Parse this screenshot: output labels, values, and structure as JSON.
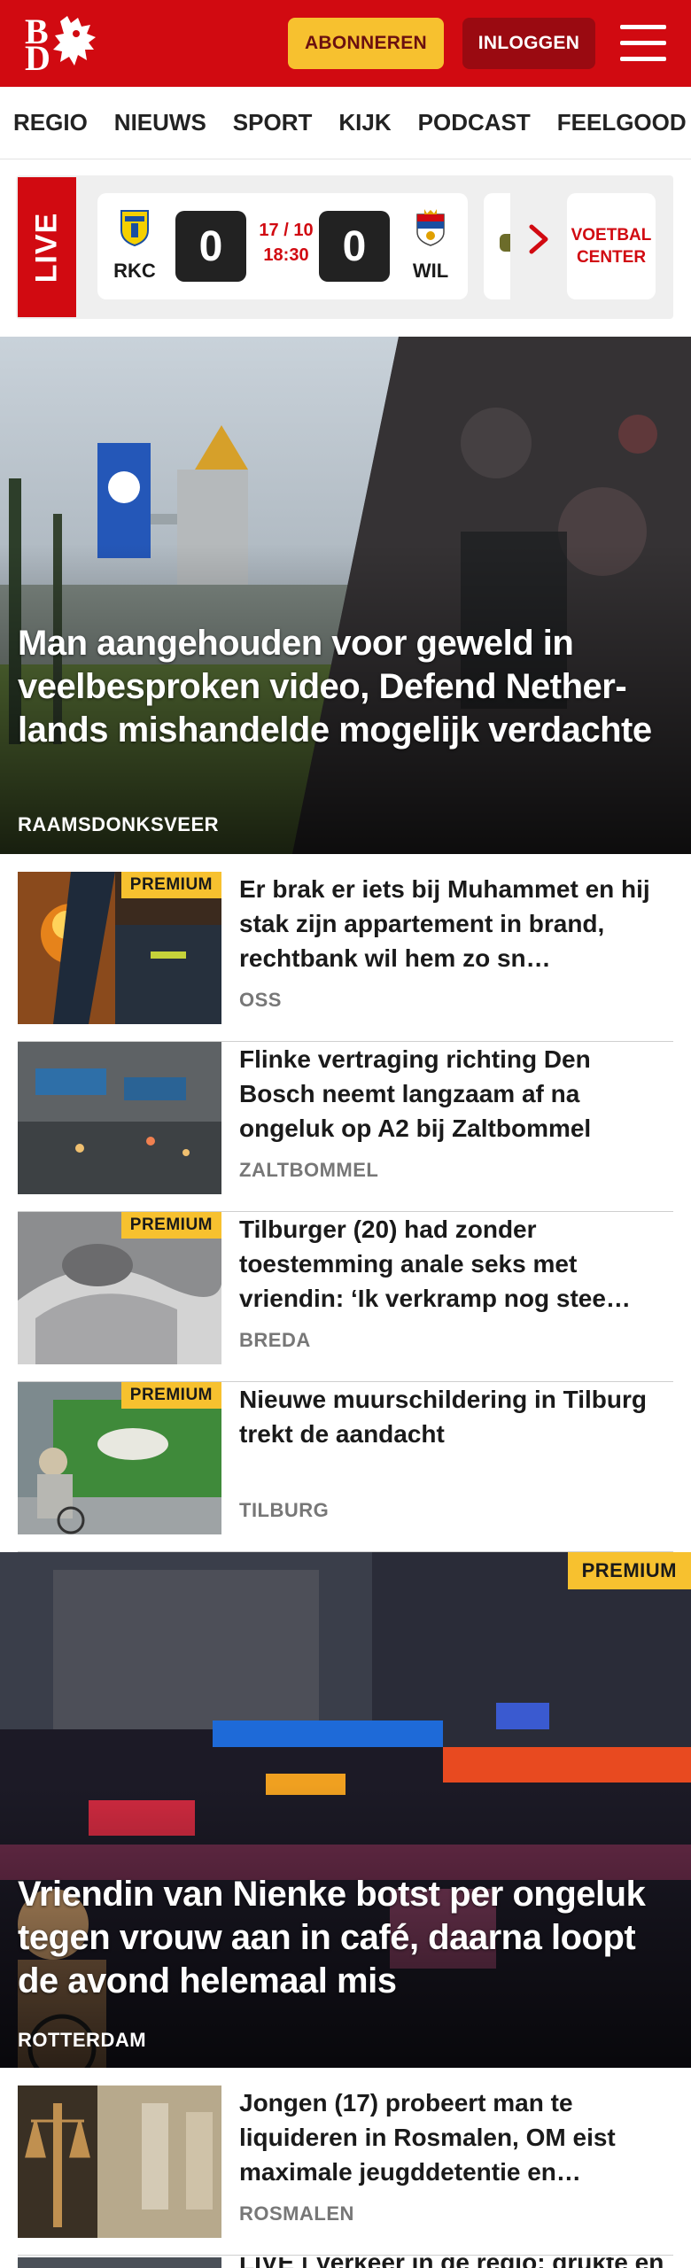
{
  "header": {
    "logo_letters": [
      "B",
      "D"
    ],
    "subscribe_label": "ABONNEREN",
    "login_label": "INLOGGEN",
    "menu_icon": "hamburger-icon",
    "brand_color": "#d10a11",
    "accent_color": "#f7c12f"
  },
  "nav": {
    "items": [
      "REGIO",
      "NIEUWS",
      "SPORT",
      "KIJK",
      "PODCAST",
      "FEELGOOD"
    ]
  },
  "live": {
    "badge": "LIVE",
    "match": {
      "home_team": "RKC",
      "home_score": "0",
      "date": "17 / 10",
      "time": "18:30",
      "away_score": "0",
      "away_team": "WIL"
    },
    "next_icon": "chevron-right-icon",
    "voetbal_center_label": "VOETBAL CENTER"
  },
  "hero": {
    "title": "Man aangehouden voor geweld in veelbesproken video, Defend Nether-lands mishandelde mogelijk verdachte",
    "location": "RAAMSDONKSVEER"
  },
  "articles": [
    {
      "premium": "PREMIUM",
      "title": "Er brak er iets bij Muhammet en hij stak zijn appartement in brand, rechtbank wil hem zo sn…",
      "location": "OSS"
    },
    {
      "premium": "",
      "title": "Flinke vertraging richting Den Bosch neemt langzaam af na ongeluk op A2 bij Zaltbommel",
      "location": "ZALTBOMMEL"
    },
    {
      "premium": "PREMIUM",
      "title": "Tilburger (20) had zonder toestemming anale seks met vriendin: ‘Ik verkramp nog stee…",
      "location": "BREDA"
    },
    {
      "premium": "PREMIUM",
      "title": "Nieuwe muurschildering in Tilburg trekt de aandacht",
      "location": "TILBURG"
    }
  ],
  "big_article": {
    "premium": "PREMIUM",
    "title": "Vriendin van Nienke botst per ongeluk tegen vrouw aan in café, daarna loopt de avond helemaal mis",
    "location": "ROTTERDAM"
  },
  "article_after": {
    "title": "Jongen (17) probeert man te liquideren in Rosmalen, OM eist maximale jeugddetentie en…",
    "location": "ROSMALEN"
  },
  "peek_item": {
    "title": "LIVE | Verkeer in de regio: drukte en"
  }
}
